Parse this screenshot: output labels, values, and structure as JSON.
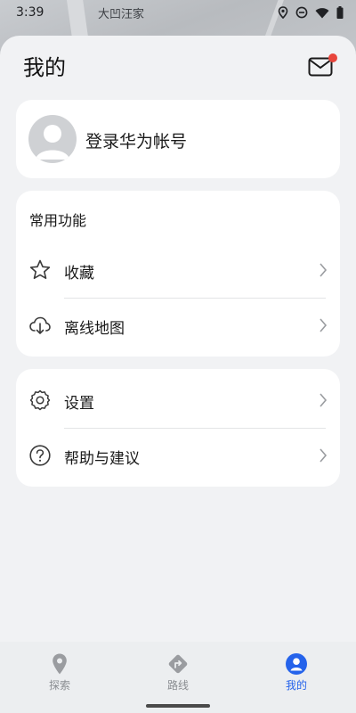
{
  "status_bar": {
    "time": "3:39"
  },
  "map": {
    "place_label": "大凹汪家"
  },
  "header": {
    "title": "我的",
    "mail_has_badge": true
  },
  "login": {
    "label": "登录华为帐号"
  },
  "common": {
    "title": "常用功能",
    "items": [
      {
        "label": "收藏",
        "icon": "star-icon"
      },
      {
        "label": "离线地图",
        "icon": "cloud-download-icon"
      }
    ]
  },
  "settings": {
    "items": [
      {
        "label": "设置",
        "icon": "gear-icon"
      },
      {
        "label": "帮助与建议",
        "icon": "help-icon"
      }
    ]
  },
  "bottom_nav": {
    "items": [
      {
        "label": "探索",
        "icon": "location-pin-icon",
        "active": false
      },
      {
        "label": "路线",
        "icon": "route-icon",
        "active": false
      },
      {
        "label": "我的",
        "icon": "person-icon",
        "active": true
      }
    ]
  },
  "colors": {
    "accent": "#2563eb",
    "badge": "#e8453c",
    "background": "#f1f2f4",
    "card": "#ffffff"
  }
}
